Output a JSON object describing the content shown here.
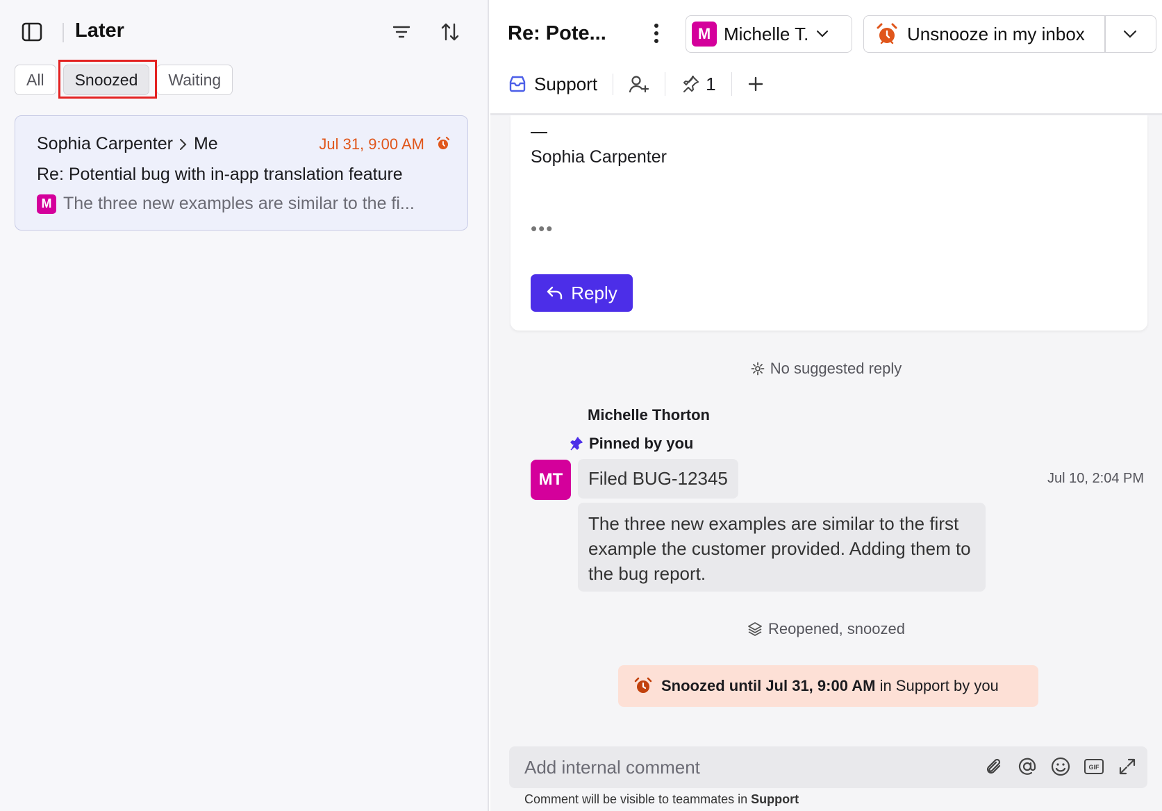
{
  "left": {
    "title": "Later",
    "tabs": [
      {
        "label": "All",
        "active": false
      },
      {
        "label": "Snoozed",
        "active": true
      },
      {
        "label": "Waiting",
        "active": false
      }
    ],
    "conversation": {
      "from": "Sophia Carpenter",
      "to": "Me",
      "date": "Jul 31, 9:00 AM",
      "subject": "Re: Potential bug with in-app translation feature",
      "avatar_initial": "M",
      "preview": "The three new examples are similar to the fi..."
    }
  },
  "right": {
    "title": "Re: Pote...",
    "assignee": {
      "initial": "M",
      "name": "Michelle T."
    },
    "snooze_action": "Unsnooze in my inbox",
    "inbox": "Support",
    "pin_count": "1",
    "message": {
      "signature_name": "Sophia Carpenter",
      "ellipsis": "•••",
      "reply_label": "Reply"
    },
    "no_suggested_reply": "No suggested reply",
    "comment": {
      "author": "Michelle Thorton",
      "pinned_label": "Pinned by you",
      "avatar": "MT",
      "line1": "Filed BUG-12345",
      "time": "Jul 10, 2:04 PM",
      "line2": "The three new examples are similar to the first example the customer provided. Adding them to the bug report."
    },
    "event": "Reopened, snoozed",
    "snooze_banner": {
      "bold": "Snoozed until Jul 31, 9:00 AM",
      "rest": " in Support by you"
    },
    "composer": {
      "placeholder": "Add internal comment",
      "note_prefix": "Comment will be visible to teammates in ",
      "note_inbox": "Support"
    }
  },
  "colors": {
    "accent": "#4c2ee8",
    "avatar": "#d4009b",
    "snooze_orange": "#e0561b",
    "snooze_banner_bg": "#fde0d6",
    "highlight_red": "#e32222"
  },
  "icons": [
    "sidebar-toggle-icon",
    "filter-icon",
    "sort-icon",
    "alarm-icon",
    "more-vertical-icon",
    "chevron-down-icon",
    "inbox-icon",
    "add-user-icon",
    "pin-icon",
    "plus-icon",
    "reply-arrow-icon",
    "gear-icon",
    "layers-icon",
    "paperclip-icon",
    "at-icon",
    "emoji-icon",
    "gif-icon",
    "expand-icon"
  ]
}
